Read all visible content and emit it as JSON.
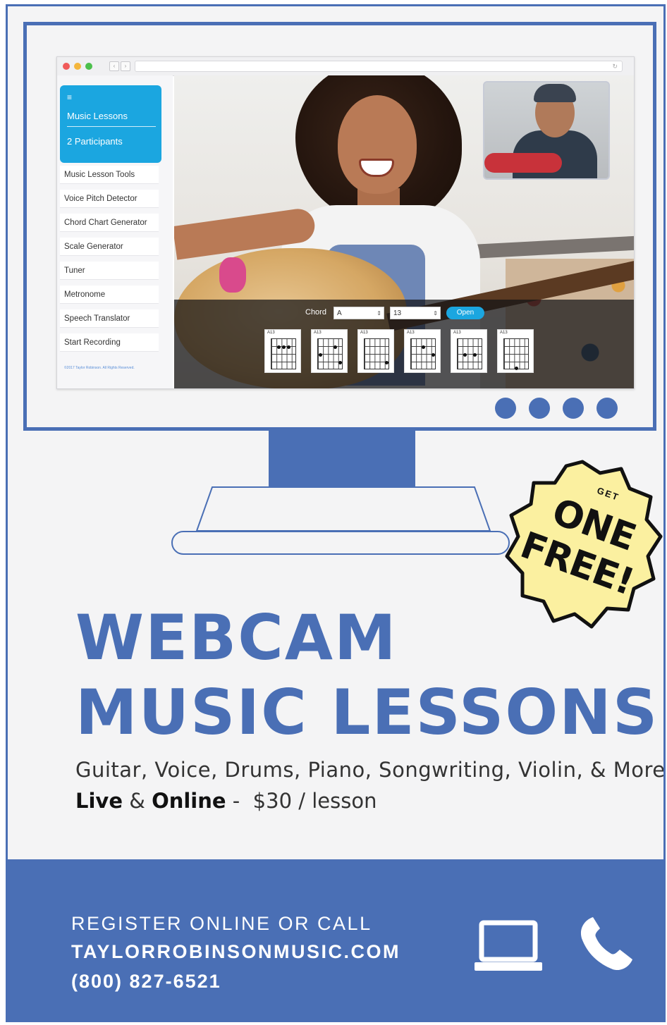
{
  "app": {
    "sidebar": {
      "menu_icon": "hamburger-menu-icon",
      "title": "Music Lessons",
      "participants": "2 Participants",
      "items": [
        {
          "label": "Music Lesson Tools"
        },
        {
          "label": "Voice Pitch Detector"
        },
        {
          "label": "Chord Chart Generator"
        },
        {
          "label": "Scale Generator"
        },
        {
          "label": "Tuner"
        },
        {
          "label": "Metronome"
        },
        {
          "label": "Speech Translator"
        },
        {
          "label": "Start Recording"
        }
      ],
      "footer": "©2017 Taylor Robinson. All Rights Reserved."
    },
    "chord_bar": {
      "label": "Chord",
      "chord_value": "A",
      "number_value": "13",
      "open_label": "Open",
      "diagram_names": [
        "A13",
        "A13",
        "A13",
        "A13",
        "A13",
        "A13"
      ]
    }
  },
  "badge": {
    "get": "GET",
    "one": "ONE",
    "free": "FREE!"
  },
  "headline": {
    "line1": "WEBCAM",
    "line2": "MUSIC LESSONS"
  },
  "subtitle": "Guitar, Voice, Drums, Piano, Songwriting, Violin, & More",
  "price_line": {
    "live": "Live",
    "amp": "&",
    "online": "Online",
    "price": "-  $30 / lesson"
  },
  "footer": {
    "line1": "REGISTER ONLINE OR CALL",
    "website": "TAYLORROBINSONMUSIC.COM",
    "phone": "(800) 827-6521",
    "icons": [
      "laptop-icon",
      "phone-icon"
    ]
  },
  "colors": {
    "brand_blue": "#4a6fb5",
    "accent_cyan": "#1ba6e0",
    "badge_yellow": "#fbf0a0"
  }
}
